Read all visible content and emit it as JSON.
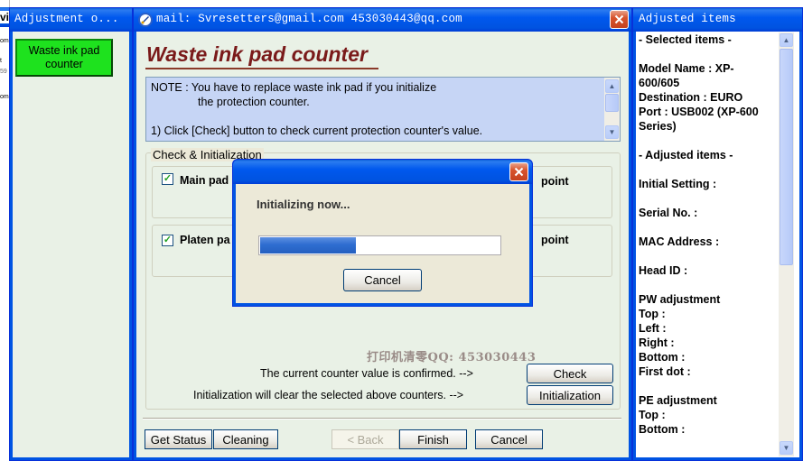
{
  "left_panel": {
    "title": "Adjustment o...",
    "nav_button": "Waste ink pad counter"
  },
  "main_window": {
    "title": "mail: Svresetters@gmail.com  453030443@qq.com",
    "heading": "Waste ink pad counter",
    "note_lines": [
      "NOTE : You have to replace waste ink pad if you initialize",
      "the protection counter.",
      "1) Click [Check] button to check current protection counter's value."
    ],
    "group_label": "Check & Initialization",
    "main_pad_label": "Main pad",
    "platen_pad_label": "Platen pa",
    "point_label_1": "point",
    "point_label_2": "point",
    "watermark": "打印机清零QQ: 453030443",
    "confirm_text": "The current counter value is confirmed. -->",
    "check_button": "Check",
    "init_text": "Initialization will clear the selected above counters. -->",
    "init_button": "Initialization",
    "bottom_buttons": {
      "get_status": "Get Status",
      "cleaning": "Cleaning",
      "back": "< Back",
      "finish": "Finish",
      "cancel": "Cancel"
    }
  },
  "progress_dialog": {
    "message": "Initializing now...",
    "progress_fraction": 0.4,
    "cancel_button": "Cancel"
  },
  "right_panel": {
    "title": "Adjusted items",
    "lines": [
      "- Selected items -",
      "Model Name : XP-",
      "600/605",
      "Destination : EURO",
      "Port : USB002 (XP-600",
      "Series)",
      "- Adjusted items -",
      "Initial Setting :",
      "Serial No. :",
      "MAC Address :",
      "Head ID :",
      "PW adjustment",
      "Top :",
      "Left :",
      "Right :",
      "Bottom :",
      "First dot :",
      "PE adjustment",
      "Top :",
      "Bottom :"
    ]
  },
  "bg_fragments": [
    "vi",
    "om",
    "t",
    "59",
    "om"
  ],
  "colors": {
    "xp_blue": "#0054e3",
    "face": "#ece9d8",
    "heading": "#7a1a1a",
    "progress": "#2f6ed1",
    "nav_button": "#1ee21e"
  }
}
